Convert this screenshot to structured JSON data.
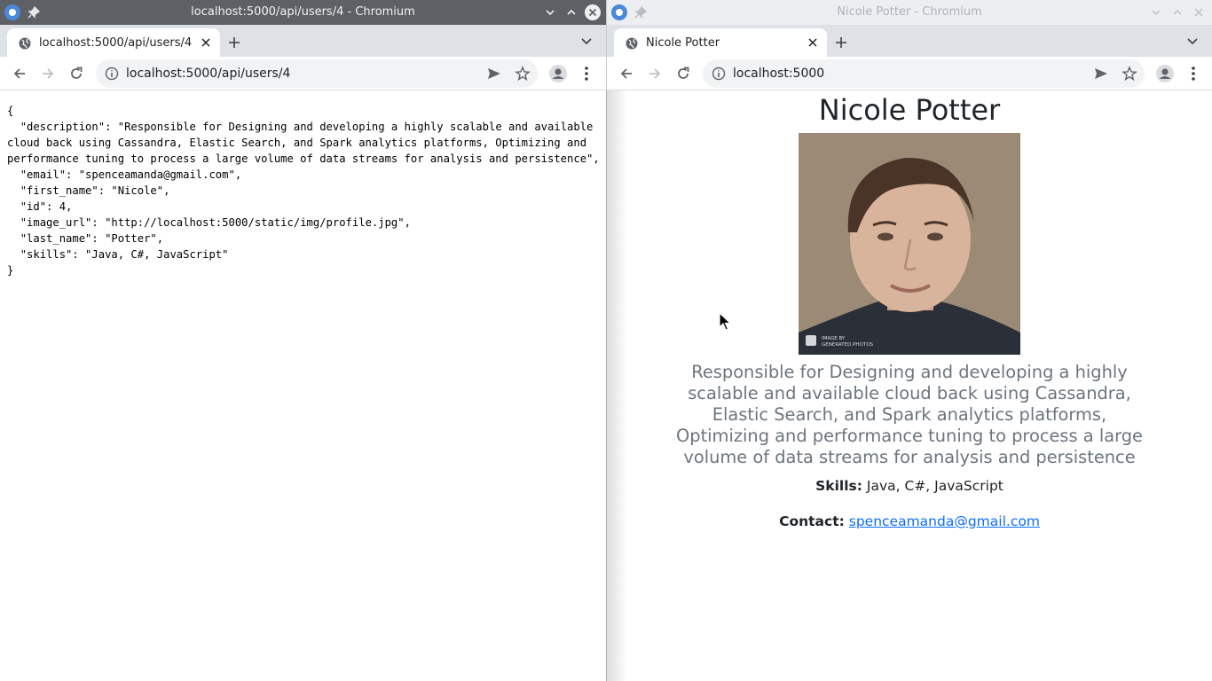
{
  "left_window": {
    "title": "localhost:5000/api/users/4 - Chromium",
    "tab_label": "localhost:5000/api/users/4",
    "url": "localhost:5000/api/users/4",
    "json_lines": [
      "{",
      "  \"description\": \"Responsible for Designing and developing a highly scalable and available cloud back using Cassandra, Elastic Search, and Spark analytics platforms, Optimizing and performance tuning to process a large volume of data streams for analysis and persistence\",",
      "  \"email\": \"spenceamanda@gmail.com\",",
      "  \"first_name\": \"Nicole\",",
      "  \"id\": 4,",
      "  \"image_url\": \"http://localhost:5000/static/img/profile.jpg\",",
      "  \"last_name\": \"Potter\",",
      "  \"skills\": \"Java, C#, JavaScript\"",
      "}"
    ]
  },
  "right_window": {
    "title": "Nicole Potter - Chromium",
    "tab_label": "Nicole Potter",
    "url": "localhost:5000",
    "page": {
      "name": "Nicole Potter",
      "photo_watermark": "IMAGE BY GENERATED.PHOTOS",
      "description": "Responsible for Designing and developing a highly scalable and available cloud back using Cassandra, Elastic Search, and Spark analytics platforms, Optimizing and performance tuning to process a large volume of data streams for analysis and persistence",
      "skills_label": "Skills:",
      "skills_value": "Java, C#, JavaScript",
      "contact_label": "Contact:",
      "contact_email": "spenceamanda@gmail.com"
    }
  },
  "colors": {
    "left_titlebar": "#5d6064",
    "right_titlebar": "#eceef1",
    "tabstrip": "#dee1e6",
    "link": "#0d6efd",
    "muted_text": "#6c757d"
  },
  "icons": [
    "chromium-logo-icon",
    "pin-icon",
    "chevron-down-icon",
    "chevron-up-icon",
    "close-icon",
    "globe-icon",
    "plus-icon",
    "back-arrow-icon",
    "forward-arrow-icon",
    "reload-icon",
    "info-icon",
    "send-icon",
    "star-icon",
    "profile-icon",
    "kebab-menu-icon",
    "mouse-cursor-icon"
  ]
}
